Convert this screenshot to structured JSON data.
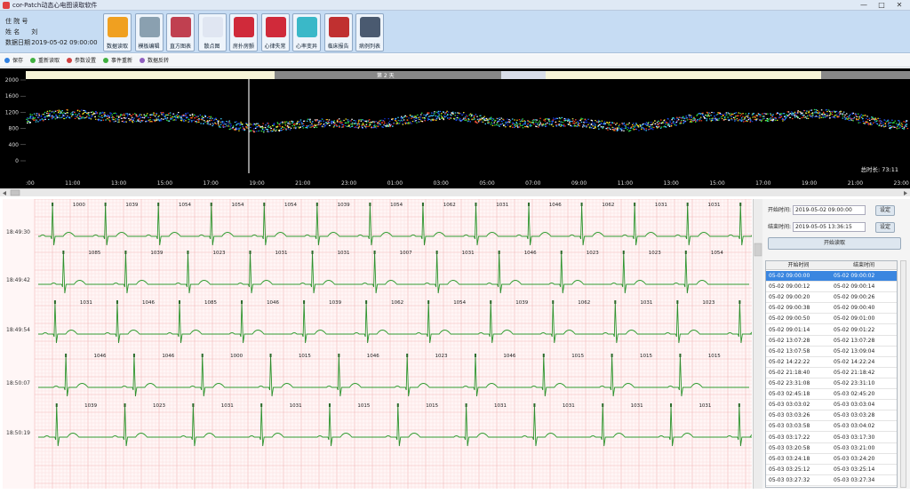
{
  "window": {
    "title": "cor-Patch动态心电图读取软件",
    "min": "—",
    "max": "□",
    "close": "✕"
  },
  "patient": {
    "id_label": "住 院 号",
    "name_label": "姓    名",
    "name_value": "刘",
    "date_label": "数据日期",
    "date_value": "2019-05-02 09:00:00"
  },
  "toolbar": [
    {
      "label": "数据读取",
      "icon": "data-read-icon",
      "color": "#f0a020"
    },
    {
      "label": "模板编辑",
      "icon": "template-edit-icon",
      "color": "#8aa0b0"
    },
    {
      "label": "直方图表",
      "icon": "histogram-icon",
      "color": "#c04050"
    },
    {
      "label": "散点图",
      "icon": "scatter-plot-icon",
      "color": "#e0e6f2"
    },
    {
      "label": "房扑房颤",
      "icon": "heart-flutter-icon",
      "color": "#d02a3a"
    },
    {
      "label": "心律失常",
      "icon": "arrhythmia-icon",
      "color": "#d02a3a"
    },
    {
      "label": "心率变异",
      "icon": "hrv-heart-icon",
      "color": "#3ab8c8"
    },
    {
      "label": "临床报告",
      "icon": "clinical-report-icon",
      "color": "#c03030"
    },
    {
      "label": "病例列表",
      "icon": "case-list-icon",
      "color": "#4a5a70"
    }
  ],
  "menu": [
    {
      "label": "保存",
      "color": "#3080e0"
    },
    {
      "label": "重新读取",
      "color": "#40b040"
    },
    {
      "label": "参数设置",
      "color": "#d04040"
    },
    {
      "label": "事件重新",
      "color": "#40b040"
    },
    {
      "label": "数据反转",
      "color": "#9060c0"
    }
  ],
  "overview": {
    "day_label": "第 2 天",
    "y_ticks": [
      "2000",
      "1600",
      "1200",
      "800",
      "400",
      "0"
    ],
    "x_ticks": [
      "09:00",
      "11:00",
      "13:00",
      "15:00",
      "17:00",
      "19:00",
      "21:00",
      "23:00",
      "01:00",
      "03:00",
      "05:00",
      "07:00",
      "09:00",
      "11:00",
      "13:00",
      "15:00",
      "17:00",
      "19:00",
      "21:00",
      "23:00"
    ],
    "total_label": "总时长: 73:11",
    "ylim": [
      0,
      2000
    ]
  },
  "ecg": {
    "times": [
      "18:49:30",
      "18:49:42",
      "18:49:54",
      "18:50:07",
      "18:50:19"
    ],
    "rows": [
      {
        "rr": [
          "1000",
          "1039",
          "1054",
          "1054",
          "1054",
          "1039",
          "1054",
          "1062",
          "1031",
          "1046",
          "1062",
          "1031",
          "1031"
        ]
      },
      {
        "rr": [
          "1085",
          "1039",
          "1023",
          "1031",
          "1031",
          "1007",
          "1031",
          "1046",
          "1023",
          "1023",
          "1054"
        ]
      },
      {
        "rr": [
          "1031",
          "1046",
          "1085",
          "1046",
          "1039",
          "1062",
          "1054",
          "1039",
          "1062",
          "1031",
          "1023"
        ]
      },
      {
        "rr": [
          "1046",
          "1046",
          "1000",
          "1015",
          "1046",
          "1023",
          "1046",
          "1015",
          "1015",
          "1015"
        ]
      },
      {
        "rr": [
          "1039",
          "1023",
          "1031",
          "1031",
          "1015",
          "1015",
          "1031",
          "1031",
          "1031",
          "1031"
        ]
      }
    ]
  },
  "right": {
    "start_label": "开始时间:",
    "start_value": "2019-05-02 09:00:00",
    "end_label": "结束时间:",
    "end_value": "2019-05-05 13:36:15",
    "set_label": "设定",
    "read_label": "开始读取",
    "table": {
      "headers": [
        "开始时间",
        "结束时间"
      ],
      "rows": [
        [
          "05-02 09:00:00",
          "05-02 09:00:02"
        ],
        [
          "05-02 09:00:12",
          "05-02 09:00:14"
        ],
        [
          "05-02 09:00:20",
          "05-02 09:00:26"
        ],
        [
          "05-02 09:00:38",
          "05-02 09:00:40"
        ],
        [
          "05-02 09:00:50",
          "05-02 09:01:00"
        ],
        [
          "05-02 09:01:14",
          "05-02 09:01:22"
        ],
        [
          "05-02 13:07:28",
          "05-02 13:07:28"
        ],
        [
          "05-02 13:07:58",
          "05-02 13:09:04"
        ],
        [
          "05-02 14:22:22",
          "05-02 14:22:24"
        ],
        [
          "05-02 21:18:40",
          "05-02 21:18:42"
        ],
        [
          "05-02 23:31:08",
          "05-02 23:31:10"
        ],
        [
          "05-03 02:45:18",
          "05-03 02:45:20"
        ],
        [
          "05-03 03:03:02",
          "05-03 03:03:04"
        ],
        [
          "05-03 03:03:26",
          "05-03 03:03:28"
        ],
        [
          "05-03 03:03:58",
          "05-03 03:04:02"
        ],
        [
          "05-03 03:17:22",
          "05-03 03:17:30"
        ],
        [
          "05-03 03:20:58",
          "05-03 03:21:00"
        ],
        [
          "05-03 03:24:18",
          "05-03 03:24:20"
        ],
        [
          "05-03 03:25:12",
          "05-03 03:25:14"
        ],
        [
          "05-03 03:27:32",
          "05-03 03:27:34"
        ]
      ]
    }
  }
}
